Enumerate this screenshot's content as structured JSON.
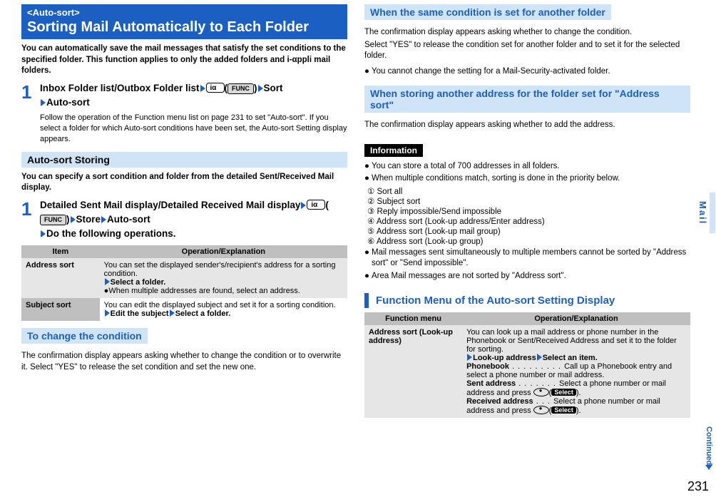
{
  "left": {
    "section": {
      "pre": "<Auto-sort>",
      "title": "Sorting Mail Automatically to Each Folder"
    },
    "intro": "You can automatically save the mail messages that satisfy the set conditions to the specified folder. This function applies to only the added folders and i-αppli mail folders.",
    "step1": {
      "head_a": "Inbox Folder list/Outbox Folder list",
      "func": "FUNC",
      "head_b": "Sort",
      "head_c": "Auto-sort",
      "note": "Follow the operation of the Function menu list on page 231 to set \"Auto-sort\". If you select a folder for which Auto-sort conditions have been set, the Auto-sort Setting display appears."
    },
    "autosort_head": "Auto-sort Storing",
    "autosort_intro": "You can specify a sort condition and folder from the detailed Sent/Received Mail display.",
    "step2": {
      "head_a": "Detailed Sent Mail display/Detailed Received Mail display",
      "func": "FUNC",
      "head_b": "Store",
      "head_c": "Auto-sort",
      "head_d": "Do the following operations."
    },
    "table": {
      "item_h": "Item",
      "op_h": "Operation/Explanation",
      "r1_item": "Address sort",
      "r1_op1": "You can set the displayed sender's/recipient's address for a sorting condition.",
      "r1_op2": "Select a folder.",
      "r1_op3": "When multiple addresses are found, select an address.",
      "r2_item": "Subject sort",
      "r2_op1": "You can edit the displayed subject and set it for a sorting condition.",
      "r2_op2a": "Edit the subject",
      "r2_op2b": "Select a folder."
    },
    "change_head": "To change the condition",
    "change_body": "The confirmation display appears asking whether to change the condition or to overwrite it. Select \"YES\" to release the set condition and set the new one."
  },
  "right": {
    "same_head": "When the same condition is set for another folder",
    "same_body1": "The confirmation display appears asking whether to change the condition.",
    "same_body2": "Select \"YES\" to release the condition set for another folder and to set it for the selected folder.",
    "same_body3": "You cannot change the setting for a Mail-Security-activated folder.",
    "store_head": "When storing another address for the folder set for \"Address sort\"",
    "store_body": "The confirmation display appears asking whether to add the address.",
    "info_head": "Information",
    "info": {
      "b1": "You can store a total of 700 addresses in all folders.",
      "b2": "When multiple conditions match, sorting is done in the priority below.",
      "l1": "Sort all",
      "l2": "Subject sort",
      "l3": "Reply impossible/Send impossible",
      "l4": "Address sort (Look-up address/Enter address)",
      "l5": "Address sort (Look-up mail group)",
      "l6": "Address sort (Look-up group)",
      "b3": "Mail messages sent simultaneously to multiple members cannot be sorted by \"Address sort\" or \"Send impossible\".",
      "b4": "Area Mail messages are not sorted by \"Address sort\"."
    },
    "func_head": "Function Menu of the Auto-sort Setting Display",
    "table": {
      "item_h": "Function menu",
      "op_h": "Operation/Explanation",
      "r1_item": "Address sort (Look-up address)",
      "r1_intro": "You can look up a mail address or phone number in the Phonebook or Sent/Received Address and set it to the folder for sorting.",
      "r1_action_a": "Look-up address",
      "r1_action_b": "Select an item.",
      "r1_pb_label": "Phonebook",
      "r1_pb_desc": "Call up a Phonebook entry and select a phone number or mail address.",
      "r1_sa_label": "Sent address",
      "r1_sa_desc": "Select a phone number or mail address and press ",
      "r1_ra_label": "Received address",
      "r1_ra_desc": "Select a phone number or mail address and press ",
      "select": "Select"
    }
  },
  "side_tab": "Mail",
  "continued": "Continued",
  "page_num": "231"
}
